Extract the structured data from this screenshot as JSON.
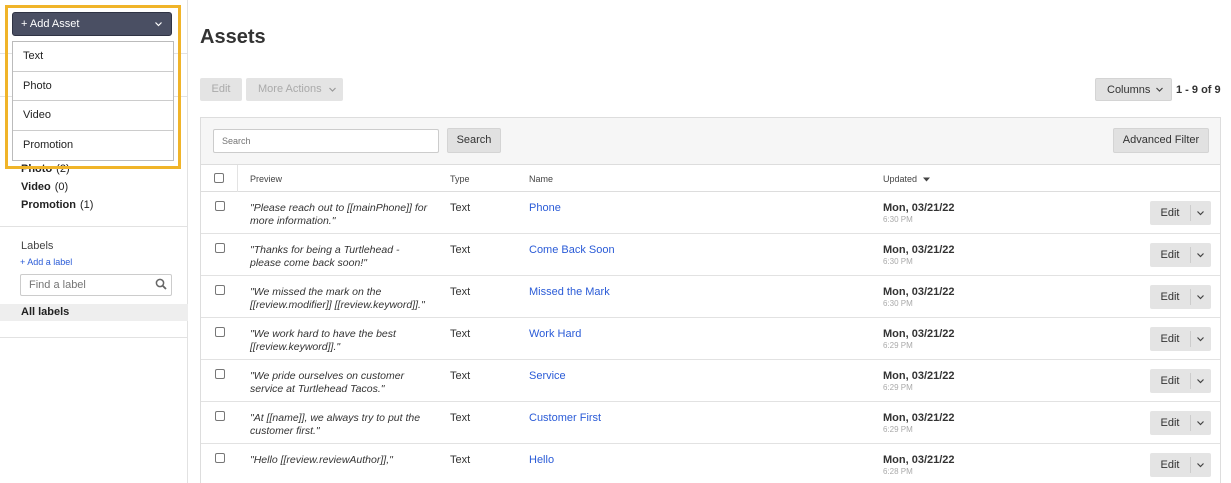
{
  "add_asset": {
    "button_label": "+  Add Asset",
    "menu": [
      "Text",
      "Photo",
      "Video",
      "Promotion"
    ]
  },
  "sidebar": {
    "types": [
      {
        "name": "Photo",
        "count": "(2)"
      },
      {
        "name": "Video",
        "count": "(0)"
      },
      {
        "name": "Promotion",
        "count": "(1)"
      }
    ],
    "labels_title": "Labels",
    "add_label": "+ Add a label",
    "find_label_placeholder": "Find a label",
    "all_labels": "All labels"
  },
  "main": {
    "title": "Assets",
    "edit_label": "Edit",
    "more_actions_label": "More Actions",
    "columns_label": "Columns",
    "pager": "1 - 9 of 9",
    "search_placeholder": "Search",
    "search_button": "Search",
    "advanced_filter": "Advanced Filter"
  },
  "table": {
    "headers": {
      "preview": "Preview",
      "type": "Type",
      "name": "Name",
      "updated": "Updated"
    },
    "row_edit_label": "Edit",
    "rows": [
      {
        "preview": "\"Please reach out to [[mainPhone]] for more information.\"",
        "type": "Text",
        "name": "Phone",
        "date": "Mon, 03/21/22",
        "time": "6:30 PM"
      },
      {
        "preview": "\"Thanks for being a Turtlehead - please come back soon!\"",
        "type": "Text",
        "name": "Come Back Soon",
        "date": "Mon, 03/21/22",
        "time": "6:30 PM"
      },
      {
        "preview": "\"We missed the mark on the [[review.modifier]] [[review.keyword]].\"",
        "type": "Text",
        "name": "Missed the Mark",
        "date": "Mon, 03/21/22",
        "time": "6:30 PM"
      },
      {
        "preview": "\"We work hard to have the best [[review.keyword]].\"",
        "type": "Text",
        "name": "Work Hard",
        "date": "Mon, 03/21/22",
        "time": "6:29 PM"
      },
      {
        "preview": "\"We pride ourselves on customer service at Turtlehead Tacos.\"",
        "type": "Text",
        "name": "Service",
        "date": "Mon, 03/21/22",
        "time": "6:29 PM"
      },
      {
        "preview": "\"At [[name]], we always try to put the customer first.\"",
        "type": "Text",
        "name": "Customer First",
        "date": "Mon, 03/21/22",
        "time": "6:29 PM"
      },
      {
        "preview": "\"Hello [[review.reviewAuthor]],\"",
        "type": "Text",
        "name": "Hello",
        "date": "Mon, 03/21/22",
        "time": "6:28 PM"
      }
    ]
  },
  "colors": {
    "highlight": "#f0b429",
    "link": "#2a5bd7",
    "add_button": "#4a4f63"
  }
}
